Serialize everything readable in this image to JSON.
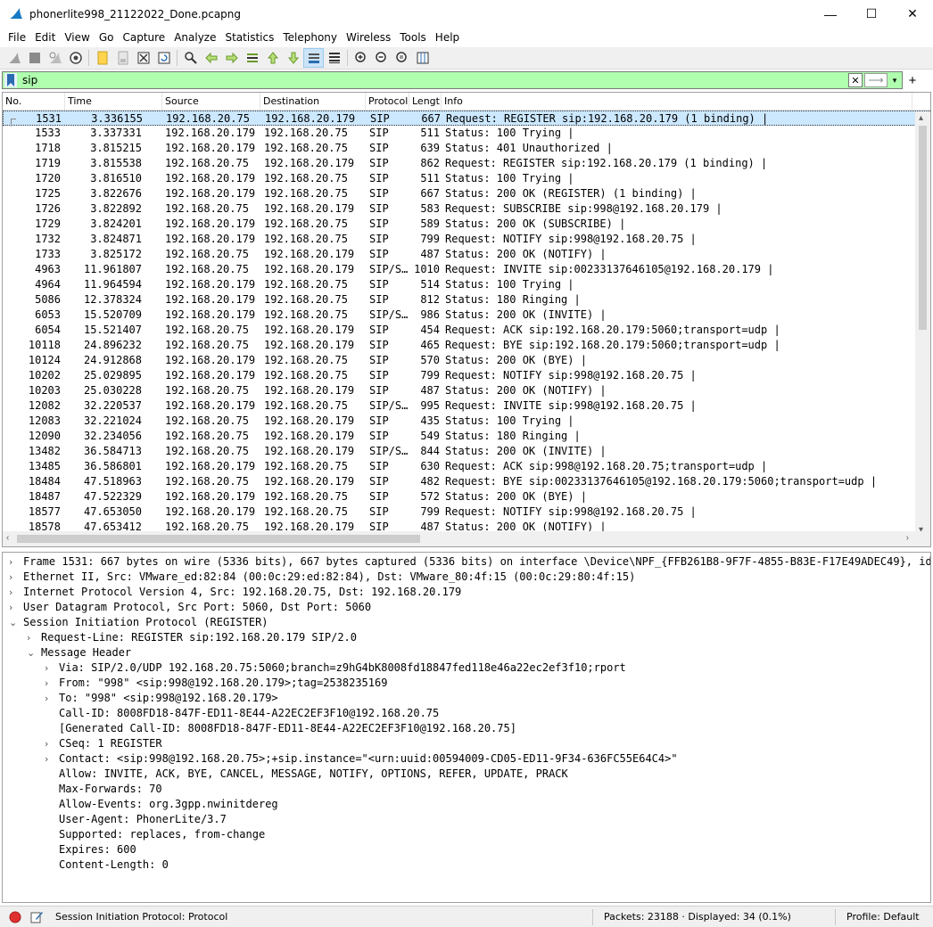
{
  "window": {
    "title": "phonerlite998_21122022_Done.pcapng",
    "minimize": "—",
    "maximize": "☐",
    "close": "✕"
  },
  "menu": [
    "File",
    "Edit",
    "View",
    "Go",
    "Capture",
    "Analyze",
    "Statistics",
    "Telephony",
    "Wireless",
    "Tools",
    "Help"
  ],
  "toolbar_icons": [
    "start-capture-icon",
    "stop-capture-icon",
    "restart-capture-icon",
    "capture-options-icon",
    "open-file-icon",
    "save-file-icon",
    "close-file-icon",
    "reload-file-icon",
    "find-packet-icon",
    "go-back-icon",
    "go-forward-icon",
    "go-to-packet-icon",
    "go-first-icon",
    "go-last-icon",
    "autoscroll-icon",
    "colorize-icon",
    "zoom-in-icon",
    "zoom-out-icon",
    "normal-size-icon",
    "resize-columns-icon"
  ],
  "filter": {
    "value": "sip",
    "clear": "✕",
    "apply": "⟶",
    "dropdown": "▾",
    "add": "+"
  },
  "packet_list": {
    "columns": [
      "No.",
      "Time",
      "Source",
      "Destination",
      "Protocol",
      "Lengt",
      "Info"
    ],
    "rows": [
      {
        "no": "1531",
        "time": "3.336155",
        "src": "192.168.20.75",
        "dst": "192.168.20.179",
        "proto": "SIP",
        "len": "667",
        "info": "Request: REGISTER sip:192.168.20.179  (1 binding)  |"
      },
      {
        "no": "1533",
        "time": "3.337331",
        "src": "192.168.20.179",
        "dst": "192.168.20.75",
        "proto": "SIP",
        "len": "511",
        "info": "Status: 100 Trying |"
      },
      {
        "no": "1718",
        "time": "3.815215",
        "src": "192.168.20.179",
        "dst": "192.168.20.75",
        "proto": "SIP",
        "len": "639",
        "info": "Status: 401 Unauthorized |"
      },
      {
        "no": "1719",
        "time": "3.815538",
        "src": "192.168.20.75",
        "dst": "192.168.20.179",
        "proto": "SIP",
        "len": "862",
        "info": "Request: REGISTER sip:192.168.20.179  (1 binding) |"
      },
      {
        "no": "1720",
        "time": "3.816510",
        "src": "192.168.20.179",
        "dst": "192.168.20.75",
        "proto": "SIP",
        "len": "511",
        "info": "Status: 100 Trying |"
      },
      {
        "no": "1725",
        "time": "3.822676",
        "src": "192.168.20.179",
        "dst": "192.168.20.75",
        "proto": "SIP",
        "len": "667",
        "info": "Status: 200 OK (REGISTER)  (1 binding) |"
      },
      {
        "no": "1726",
        "time": "3.822892",
        "src": "192.168.20.75",
        "dst": "192.168.20.179",
        "proto": "SIP",
        "len": "583",
        "info": "Request: SUBSCRIBE sip:998@192.168.20.179 |"
      },
      {
        "no": "1729",
        "time": "3.824201",
        "src": "192.168.20.179",
        "dst": "192.168.20.75",
        "proto": "SIP",
        "len": "589",
        "info": "Status: 200 OK (SUBSCRIBE) |"
      },
      {
        "no": "1732",
        "time": "3.824871",
        "src": "192.168.20.179",
        "dst": "192.168.20.75",
        "proto": "SIP",
        "len": "799",
        "info": "Request: NOTIFY sip:998@192.168.20.75 |"
      },
      {
        "no": "1733",
        "time": "3.825172",
        "src": "192.168.20.75",
        "dst": "192.168.20.179",
        "proto": "SIP",
        "len": "487",
        "info": "Status: 200 OK (NOTIFY) |"
      },
      {
        "no": "4963",
        "time": "11.961807",
        "src": "192.168.20.75",
        "dst": "192.168.20.179",
        "proto": "SIP/S…",
        "len": "1010",
        "info": "Request: INVITE sip:00233137646105@192.168.20.179 |"
      },
      {
        "no": "4964",
        "time": "11.964594",
        "src": "192.168.20.179",
        "dst": "192.168.20.75",
        "proto": "SIP",
        "len": "514",
        "info": "Status: 100 Trying |"
      },
      {
        "no": "5086",
        "time": "12.378324",
        "src": "192.168.20.179",
        "dst": "192.168.20.75",
        "proto": "SIP",
        "len": "812",
        "info": "Status: 180 Ringing |"
      },
      {
        "no": "6053",
        "time": "15.520709",
        "src": "192.168.20.179",
        "dst": "192.168.20.75",
        "proto": "SIP/S…",
        "len": "986",
        "info": "Status: 200 OK (INVITE) |"
      },
      {
        "no": "6054",
        "time": "15.521407",
        "src": "192.168.20.75",
        "dst": "192.168.20.179",
        "proto": "SIP",
        "len": "454",
        "info": "Request: ACK sip:192.168.20.179:5060;transport=udp |"
      },
      {
        "no": "10118",
        "time": "24.896232",
        "src": "192.168.20.75",
        "dst": "192.168.20.179",
        "proto": "SIP",
        "len": "465",
        "info": "Request: BYE sip:192.168.20.179:5060;transport=udp |"
      },
      {
        "no": "10124",
        "time": "24.912868",
        "src": "192.168.20.179",
        "dst": "192.168.20.75",
        "proto": "SIP",
        "len": "570",
        "info": "Status: 200 OK (BYE) |"
      },
      {
        "no": "10202",
        "time": "25.029895",
        "src": "192.168.20.179",
        "dst": "192.168.20.75",
        "proto": "SIP",
        "len": "799",
        "info": "Request: NOTIFY sip:998@192.168.20.75 |"
      },
      {
        "no": "10203",
        "time": "25.030228",
        "src": "192.168.20.75",
        "dst": "192.168.20.179",
        "proto": "SIP",
        "len": "487",
        "info": "Status: 200 OK (NOTIFY) |"
      },
      {
        "no": "12082",
        "time": "32.220537",
        "src": "192.168.20.179",
        "dst": "192.168.20.75",
        "proto": "SIP/S…",
        "len": "995",
        "info": "Request: INVITE sip:998@192.168.20.75 |"
      },
      {
        "no": "12083",
        "time": "32.221024",
        "src": "192.168.20.75",
        "dst": "192.168.20.179",
        "proto": "SIP",
        "len": "435",
        "info": "Status: 100 Trying |"
      },
      {
        "no": "12090",
        "time": "32.234056",
        "src": "192.168.20.75",
        "dst": "192.168.20.179",
        "proto": "SIP",
        "len": "549",
        "info": "Status: 180 Ringing |"
      },
      {
        "no": "13482",
        "time": "36.584713",
        "src": "192.168.20.75",
        "dst": "192.168.20.179",
        "proto": "SIP/S…",
        "len": "844",
        "info": "Status: 200 OK (INVITE) |"
      },
      {
        "no": "13485",
        "time": "36.586801",
        "src": "192.168.20.179",
        "dst": "192.168.20.75",
        "proto": "SIP",
        "len": "630",
        "info": "Request: ACK sip:998@192.168.20.75;transport=udp |"
      },
      {
        "no": "18484",
        "time": "47.518963",
        "src": "192.168.20.75",
        "dst": "192.168.20.179",
        "proto": "SIP",
        "len": "482",
        "info": "Request: BYE sip:00233137646105@192.168.20.179:5060;transport=udp |"
      },
      {
        "no": "18487",
        "time": "47.522329",
        "src": "192.168.20.179",
        "dst": "192.168.20.75",
        "proto": "SIP",
        "len": "572",
        "info": "Status: 200 OK (BYE) |"
      },
      {
        "no": "18577",
        "time": "47.653050",
        "src": "192.168.20.179",
        "dst": "192.168.20.75",
        "proto": "SIP",
        "len": "799",
        "info": "Request: NOTIFY sip:998@192.168.20.75 |"
      },
      {
        "no": "18578",
        "time": "47.653412",
        "src": "192.168.20.75",
        "dst": "192.168.20.179",
        "proto": "SIP",
        "len": "487",
        "info": "Status: 200 OK (NOTIFY) |"
      }
    ]
  },
  "details": [
    {
      "indent": 0,
      "tw": "›",
      "text": "Frame 1531: 667 bytes on wire (5336 bits), 667 bytes captured (5336 bits) on interface \\Device\\NPF_{FFB261B8-9F7F-4855-B83E-F17E49ADEC49}, id 0"
    },
    {
      "indent": 0,
      "tw": "›",
      "text": "Ethernet II, Src: VMware_ed:82:84 (00:0c:29:ed:82:84), Dst: VMware_80:4f:15 (00:0c:29:80:4f:15)"
    },
    {
      "indent": 0,
      "tw": "›",
      "text": "Internet Protocol Version 4, Src: 192.168.20.75, Dst: 192.168.20.179"
    },
    {
      "indent": 0,
      "tw": "›",
      "text": "User Datagram Protocol, Src Port: 5060, Dst Port: 5060"
    },
    {
      "indent": 0,
      "tw": "⌄",
      "text": "Session Initiation Protocol (REGISTER)"
    },
    {
      "indent": 1,
      "tw": "›",
      "text": "Request-Line: REGISTER sip:192.168.20.179 SIP/2.0"
    },
    {
      "indent": 1,
      "tw": "⌄",
      "text": "Message Header"
    },
    {
      "indent": 2,
      "tw": "›",
      "text": "Via: SIP/2.0/UDP 192.168.20.75:5060;branch=z9hG4bK8008fd18847fed118e46a22ec2ef3f10;rport"
    },
    {
      "indent": 2,
      "tw": "›",
      "text": "From: \"998\" <sip:998@192.168.20.179>;tag=2538235169"
    },
    {
      "indent": 2,
      "tw": "›",
      "text": "To: \"998\" <sip:998@192.168.20.179>"
    },
    {
      "indent": 2,
      "tw": "",
      "text": "Call-ID: 8008FD18-847F-ED11-8E44-A22EC2EF3F10@192.168.20.75"
    },
    {
      "indent": 2,
      "tw": "",
      "text": "[Generated Call-ID: 8008FD18-847F-ED11-8E44-A22EC2EF3F10@192.168.20.75]"
    },
    {
      "indent": 2,
      "tw": "›",
      "text": "CSeq: 1 REGISTER"
    },
    {
      "indent": 2,
      "tw": "›",
      "text": "Contact: <sip:998@192.168.20.75>;+sip.instance=\"<urn:uuid:00594009-CD05-ED11-9F34-636FC55E64C4>\""
    },
    {
      "indent": 2,
      "tw": "",
      "text": "Allow: INVITE, ACK, BYE, CANCEL, MESSAGE, NOTIFY, OPTIONS, REFER, UPDATE, PRACK"
    },
    {
      "indent": 2,
      "tw": "",
      "text": "Max-Forwards: 70"
    },
    {
      "indent": 2,
      "tw": "",
      "text": "Allow-Events: org.3gpp.nwinitdereg"
    },
    {
      "indent": 2,
      "tw": "",
      "text": "User-Agent: PhonerLite/3.7"
    },
    {
      "indent": 2,
      "tw": "",
      "text": "Supported: replaces, from-change"
    },
    {
      "indent": 2,
      "tw": "",
      "text": "Expires: 600"
    },
    {
      "indent": 2,
      "tw": "",
      "text": "Content-Length: 0"
    }
  ],
  "status": {
    "protocol_text": "Session Initiation Protocol: Protocol",
    "packets_text": "Packets: 23188 · Displayed: 34 (0.1%)",
    "profile_text": "Profile: Default"
  },
  "colors": {
    "filter_valid_bg": "#afffaf",
    "selected_row_bg": "#cce8ff",
    "record_indicator": "#e03131"
  }
}
